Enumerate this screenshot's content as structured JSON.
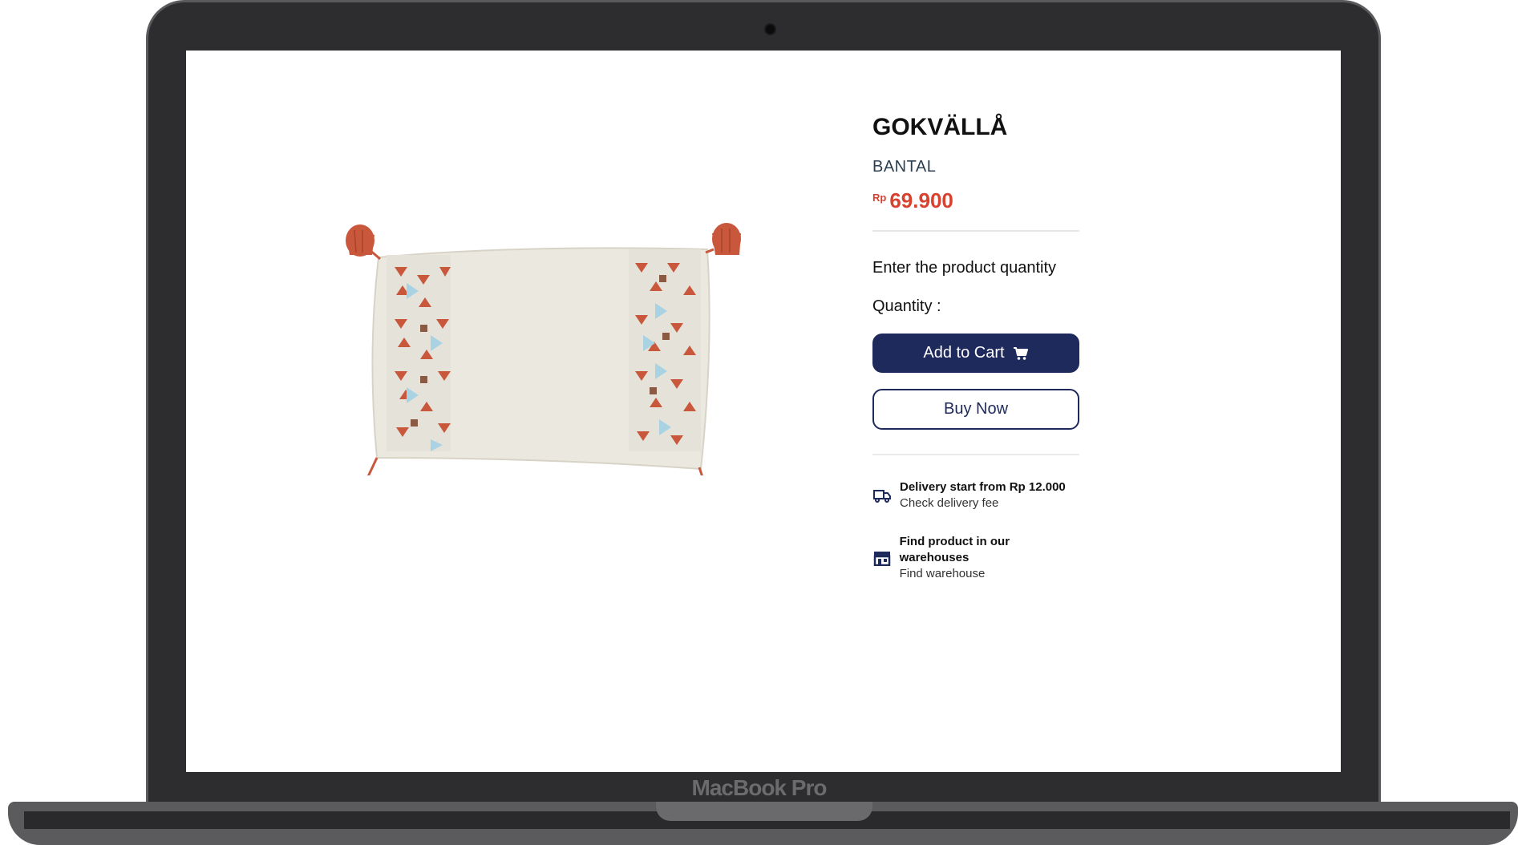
{
  "device": {
    "brand_label": "MacBook Pro"
  },
  "product": {
    "name": "GOKVÄLLÅ",
    "category": "BANTAL",
    "price_currency": "Rp",
    "price_value": "69.900",
    "image_icon": "cushion-image"
  },
  "quantity": {
    "heading": "Enter the product quantity",
    "label": "Quantity :"
  },
  "actions": {
    "add_to_cart_label": "Add to Cart",
    "add_to_cart_icon": "cart-icon",
    "buy_now_label": "Buy Now"
  },
  "info": [
    {
      "icon": "delivery-truck-icon",
      "title": "Delivery start from Rp 12.000",
      "subtitle": "Check delivery fee"
    },
    {
      "icon": "store-icon",
      "title": "Find product in our warehouses",
      "subtitle": "Find warehouse"
    }
  ],
  "colors": {
    "primary": "#1f2a5c",
    "price": "#d9412f",
    "tassel": "#c9573b",
    "cushion": "#ebe7dd"
  }
}
